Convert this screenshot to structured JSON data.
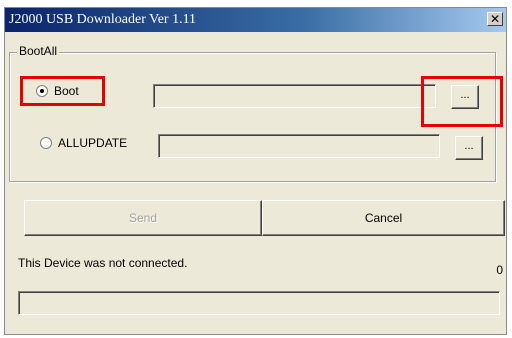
{
  "window": {
    "title": "J2000 USB Downloader Ver 1.11",
    "close_glyph": "✕"
  },
  "group": {
    "label": "BootAll",
    "options": [
      {
        "label": "Boot",
        "selected": true,
        "path_value": "",
        "browse_label": "..."
      },
      {
        "label": "ALLUPDATE",
        "selected": false,
        "path_value": "",
        "browse_label": "..."
      }
    ]
  },
  "actions": {
    "send_label": "Send",
    "send_enabled": false,
    "cancel_label": "Cancel"
  },
  "status": {
    "message": "This Device was not connected.",
    "count": "0",
    "progress": 0
  },
  "annotations": {
    "highlight_color": "#e60000",
    "highlighted": [
      "boot-radio",
      "boot-browse-button"
    ]
  }
}
